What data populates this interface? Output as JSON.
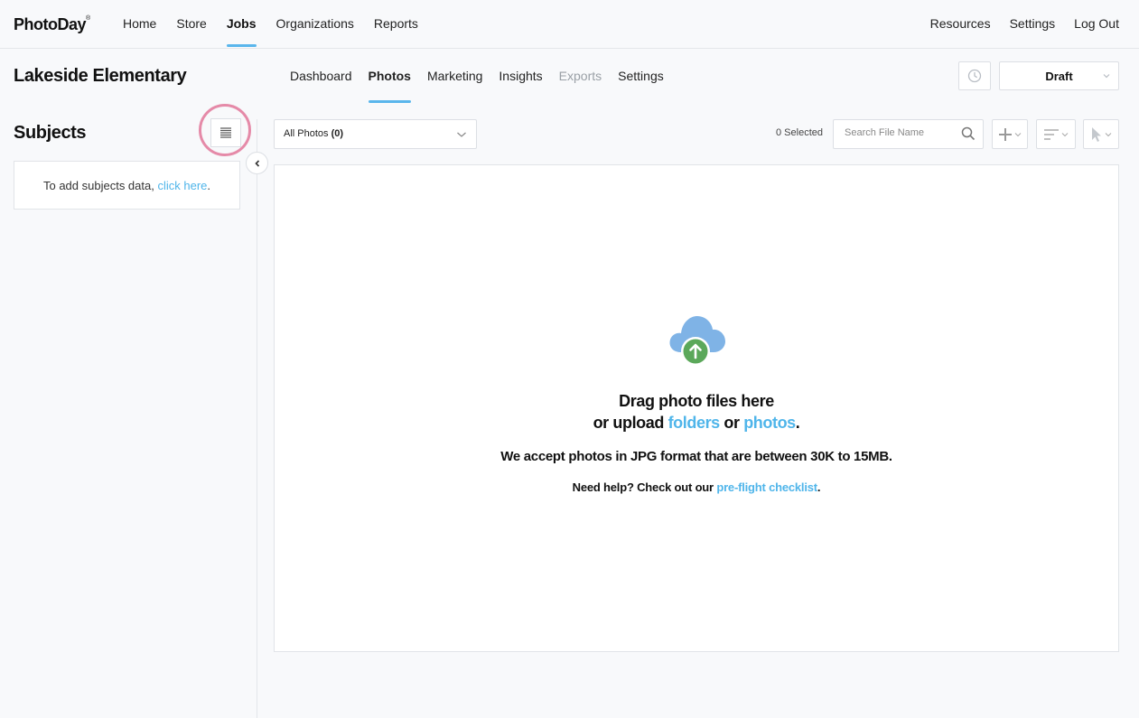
{
  "brand": {
    "name": "PhotoDay",
    "mark": "®"
  },
  "topnav": {
    "left": [
      {
        "label": "Home",
        "active": false
      },
      {
        "label": "Store",
        "active": false
      },
      {
        "label": "Jobs",
        "active": true
      },
      {
        "label": "Organizations",
        "active": false
      },
      {
        "label": "Reports",
        "active": false
      }
    ],
    "right": [
      {
        "label": "Resources"
      },
      {
        "label": "Settings"
      },
      {
        "label": "Log Out"
      }
    ]
  },
  "job": {
    "title": "Lakeside Elementary",
    "tabs": [
      {
        "label": "Dashboard",
        "state": "normal"
      },
      {
        "label": "Photos",
        "state": "active"
      },
      {
        "label": "Marketing",
        "state": "normal"
      },
      {
        "label": "Insights",
        "state": "normal"
      },
      {
        "label": "Exports",
        "state": "disabled"
      },
      {
        "label": "Settings",
        "state": "normal"
      }
    ],
    "status": "Draft"
  },
  "sidebar": {
    "title": "Subjects",
    "empty_prefix": "To add subjects data, ",
    "empty_link": "click here",
    "empty_suffix": "."
  },
  "toolbar": {
    "filter_label": "All Photos ",
    "filter_count": "(0)",
    "selected": "0 Selected",
    "search_placeholder": "Search File Name"
  },
  "dropzone": {
    "line1": "Drag photo files here",
    "line2_prefix": "or upload ",
    "folders_link": "folders",
    "line2_mid": " or ",
    "photos_link": "photos",
    "line2_suffix": ".",
    "formats": "We accept photos in JPG format that are between 30K to 15MB.",
    "help_prefix": "Need help? Check out our ",
    "help_link": "pre-flight checklist",
    "help_suffix": "."
  },
  "colors": {
    "accent": "#5ab6ec",
    "link": "#4fb5ea",
    "highlight": "#e58aa8",
    "cloud": "#7fb3e6",
    "upload_arrow": "#5ba85a"
  }
}
